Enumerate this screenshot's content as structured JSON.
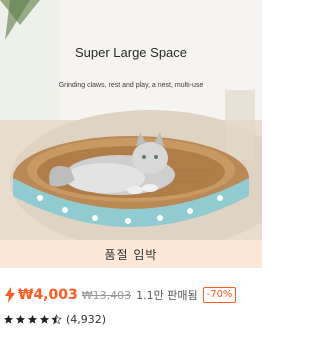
{
  "product": {
    "image": {
      "headline": "Super Large Space",
      "subline": "Grinding claws, rest and play, a nest, multi-use",
      "icon": "cat-bed-photo"
    },
    "status_label": "품절 임박",
    "price": {
      "current": "₩4,003",
      "original": "₩13,403",
      "sold": "1.1만 판매됨",
      "discount": "-70%",
      "accent_color": "#ff5a1f",
      "icon": "bolt-icon"
    },
    "rating": {
      "stars": 4.5,
      "max_stars": 5,
      "review_count": "(4,932)"
    }
  }
}
